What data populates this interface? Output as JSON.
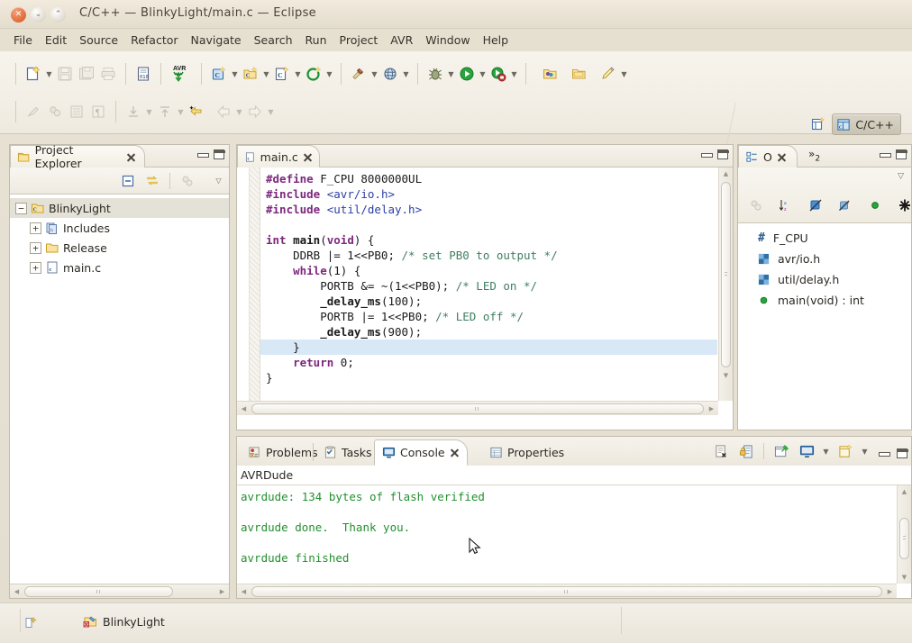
{
  "window": {
    "title": "C/C++ — BlinkyLight/main.c — Eclipse",
    "controls": [
      "close",
      "minimize",
      "maximize"
    ]
  },
  "menubar": {
    "items": [
      "File",
      "Edit",
      "Source",
      "Refactor",
      "Navigate",
      "Search",
      "Run",
      "Project",
      "AVR",
      "Window",
      "Help"
    ]
  },
  "toolbar": {
    "row1": [
      {
        "name": "new-wizard",
        "icon": "new-file-icon",
        "dropdown": true,
        "enabled": true
      },
      {
        "name": "save",
        "icon": "save-icon",
        "dropdown": false,
        "enabled": false
      },
      {
        "name": "save-all",
        "icon": "save-all-icon",
        "dropdown": false,
        "enabled": false
      },
      {
        "name": "print",
        "icon": "print-icon",
        "dropdown": false,
        "enabled": false
      },
      {
        "name": "toggle-hex",
        "icon": "hex-file-icon",
        "dropdown": false,
        "enabled": true
      },
      {
        "name": "avr-upload",
        "icon": "avr-download-icon",
        "dropdown": false,
        "enabled": true
      },
      {
        "name": "new-c-project",
        "icon": "c-project-icon",
        "dropdown": true,
        "enabled": true
      },
      {
        "name": "new-c-folder",
        "icon": "c-folder-icon",
        "dropdown": true,
        "enabled": true
      },
      {
        "name": "new-c-source",
        "icon": "c-source-icon",
        "dropdown": true,
        "enabled": true
      },
      {
        "name": "new-class",
        "icon": "green-circle-plus-icon",
        "dropdown": true,
        "enabled": true
      },
      {
        "name": "build",
        "icon": "hammer-icon",
        "dropdown": true,
        "enabled": true
      },
      {
        "name": "external-tools",
        "icon": "globe-icon",
        "dropdown": true,
        "enabled": true
      },
      {
        "name": "debug",
        "icon": "bug-icon",
        "dropdown": true,
        "enabled": true
      },
      {
        "name": "run",
        "icon": "run-play-icon",
        "dropdown": true,
        "enabled": true
      },
      {
        "name": "profile",
        "icon": "profile-icon",
        "dropdown": true,
        "enabled": true
      },
      {
        "name": "open-type",
        "icon": "open-folder-icon",
        "dropdown": false,
        "enabled": true
      },
      {
        "name": "open-resource",
        "icon": "open-folder2-icon",
        "dropdown": false,
        "enabled": true
      },
      {
        "name": "search-ref",
        "icon": "pencil-icon",
        "dropdown": true,
        "enabled": true
      }
    ],
    "row2": [
      {
        "name": "annotation",
        "icon": "brush-icon",
        "enabled": false
      },
      {
        "name": "markers",
        "icon": "marker-icon",
        "enabled": false
      },
      {
        "name": "block-select",
        "icon": "block-icon",
        "enabled": false
      },
      {
        "name": "show-whitespace",
        "icon": "pilcrow-icon",
        "enabled": false
      },
      {
        "name": "next-annotation",
        "icon": "down-arrow-icon",
        "dropdown": true,
        "enabled": false
      },
      {
        "name": "prev-annotation",
        "icon": "up-arrow-icon",
        "dropdown": true,
        "enabled": false
      },
      {
        "name": "last-edit-location",
        "icon": "last-edit-icon",
        "enabled": true
      },
      {
        "name": "back",
        "icon": "back-arrow-icon",
        "dropdown": true,
        "enabled": false
      },
      {
        "name": "forward",
        "icon": "forward-arrow-icon",
        "dropdown": true,
        "enabled": false
      }
    ],
    "perspective": {
      "open_label": "open-perspective",
      "active_label": "C/C++"
    }
  },
  "project_explorer": {
    "tab_label": "Project Explorer",
    "tree": [
      {
        "label": "BlinkyLight",
        "twisty": "−",
        "icon": "c-project-icon",
        "depth": 0,
        "selected": true
      },
      {
        "label": "Includes",
        "twisty": "+",
        "icon": "includes-icon",
        "depth": 1,
        "selected": false
      },
      {
        "label": "Release",
        "twisty": "+",
        "icon": "folder-icon",
        "depth": 1,
        "selected": false
      },
      {
        "label": "main.c",
        "twisty": "+",
        "icon": "c-file-icon",
        "depth": 1,
        "selected": false
      }
    ],
    "toolbar": [
      {
        "name": "collapse-all",
        "icon": "collapse-all-icon",
        "enabled": true
      },
      {
        "name": "link-with-editor",
        "icon": "link-editor-icon",
        "enabled": true
      },
      {
        "name": "focus-on-active",
        "icon": "focus-icon",
        "enabled": false
      },
      {
        "name": "view-menu",
        "icon": "view-menu-icon",
        "enabled": true
      }
    ]
  },
  "editor": {
    "tab_label": "main.c",
    "tab_icon": "c-file-icon",
    "highlighted_line_index": 11,
    "lines": [
      {
        "tokens": [
          {
            "t": "#define",
            "c": "pp"
          },
          {
            "t": " F_CPU 8000000UL",
            "c": ""
          }
        ]
      },
      {
        "tokens": [
          {
            "t": "#include",
            "c": "pp"
          },
          {
            "t": " ",
            "c": ""
          },
          {
            "t": "<avr/io.h>",
            "c": "inc"
          }
        ]
      },
      {
        "tokens": [
          {
            "t": "#include",
            "c": "pp"
          },
          {
            "t": " ",
            "c": ""
          },
          {
            "t": "<util/delay.h>",
            "c": "inc"
          }
        ]
      },
      {
        "tokens": []
      },
      {
        "tokens": [
          {
            "t": "int",
            "c": "kw"
          },
          {
            "t": " ",
            "c": ""
          },
          {
            "t": "main",
            "c": "fn"
          },
          {
            "t": "(",
            "c": ""
          },
          {
            "t": "void",
            "c": "kw"
          },
          {
            "t": ") {",
            "c": ""
          }
        ]
      },
      {
        "tokens": [
          {
            "t": "    DDRB |= 1<<PB0; ",
            "c": ""
          },
          {
            "t": "/* set PB0 to output */",
            "c": "cmt"
          }
        ]
      },
      {
        "tokens": [
          {
            "t": "    ",
            "c": ""
          },
          {
            "t": "while",
            "c": "kw"
          },
          {
            "t": "(1) {",
            "c": ""
          }
        ]
      },
      {
        "tokens": [
          {
            "t": "        PORTB &= ~(1<<PB0); ",
            "c": ""
          },
          {
            "t": "/* LED on */",
            "c": "cmt"
          }
        ]
      },
      {
        "tokens": [
          {
            "t": "        ",
            "c": ""
          },
          {
            "t": "_delay_ms",
            "c": "fn"
          },
          {
            "t": "(100);",
            "c": ""
          }
        ]
      },
      {
        "tokens": [
          {
            "t": "        PORTB |= 1<<PB0; ",
            "c": ""
          },
          {
            "t": "/* LED off */",
            "c": "cmt"
          }
        ]
      },
      {
        "tokens": [
          {
            "t": "        ",
            "c": ""
          },
          {
            "t": "_delay_ms",
            "c": "fn"
          },
          {
            "t": "(900);",
            "c": ""
          }
        ]
      },
      {
        "tokens": [
          {
            "t": "    }",
            "c": ""
          }
        ]
      },
      {
        "tokens": [
          {
            "t": "    ",
            "c": ""
          },
          {
            "t": "return",
            "c": "kw"
          },
          {
            "t": " 0;",
            "c": ""
          }
        ]
      },
      {
        "tokens": [
          {
            "t": "}",
            "c": ""
          }
        ]
      }
    ]
  },
  "outline": {
    "tab_label": "O",
    "overflow_label": "2",
    "toolbar": [
      {
        "name": "focus-on-selection",
        "icon": "focus-icon",
        "enabled": false
      },
      {
        "name": "sort",
        "icon": "sort-az-icon",
        "enabled": true
      },
      {
        "name": "hide-fields",
        "icon": "hide-fields-icon",
        "enabled": true
      },
      {
        "name": "hide-static",
        "icon": "hide-static-icon",
        "enabled": true
      },
      {
        "name": "hide-non-public",
        "icon": "green-dot-icon",
        "enabled": true
      },
      {
        "name": "hide-macros",
        "icon": "macro-icon",
        "enabled": true
      }
    ],
    "items": [
      {
        "label": "F_CPU",
        "icon": "macro-hash-icon"
      },
      {
        "label": "avr/io.h",
        "icon": "include-icon"
      },
      {
        "label": "util/delay.h",
        "icon": "include-icon"
      },
      {
        "label": "main(void) : int",
        "icon": "function-icon"
      }
    ]
  },
  "console": {
    "tabs": [
      {
        "label": "Problems",
        "icon": "problems-icon",
        "active": false,
        "closable": false
      },
      {
        "label": "Tasks",
        "icon": "tasks-icon",
        "active": false,
        "closable": false
      },
      {
        "label": "Console",
        "icon": "console-icon",
        "active": true,
        "closable": true
      },
      {
        "label": "Properties",
        "icon": "properties-icon",
        "active": false,
        "closable": false
      }
    ],
    "title": "AVRDude",
    "lines": [
      "avrdude: 134 bytes of flash verified",
      "",
      "avrdude done.  Thank you.",
      "",
      "avrdude finished"
    ],
    "text_color": "#22902f",
    "tools": [
      {
        "name": "clear-console",
        "icon": "clear-console-icon",
        "enabled": true
      },
      {
        "name": "scroll-lock",
        "icon": "lock-icon",
        "enabled": true
      },
      {
        "name": "pin-console",
        "icon": "pin-icon",
        "enabled": true
      },
      {
        "name": "display-console",
        "icon": "display-console-icon",
        "dropdown": true,
        "enabled": true
      },
      {
        "name": "open-console",
        "icon": "new-console-icon",
        "dropdown": true,
        "enabled": true
      }
    ]
  },
  "statusbar": {
    "project_label": "BlinkyLight",
    "project_icon": "c-project-build-icon",
    "left_icon": "smart-insert-icon"
  },
  "colors": {
    "chrome": "#e6e0d1",
    "toolbar": "#f3efe6",
    "panel_border": "#c0bbad",
    "selection": "#d9e8f7",
    "tree_selection": "#e4e1d7",
    "keyword": "#7c287c",
    "include": "#2a3fa5",
    "comment": "#3f7f5f",
    "console_green": "#22902f"
  }
}
